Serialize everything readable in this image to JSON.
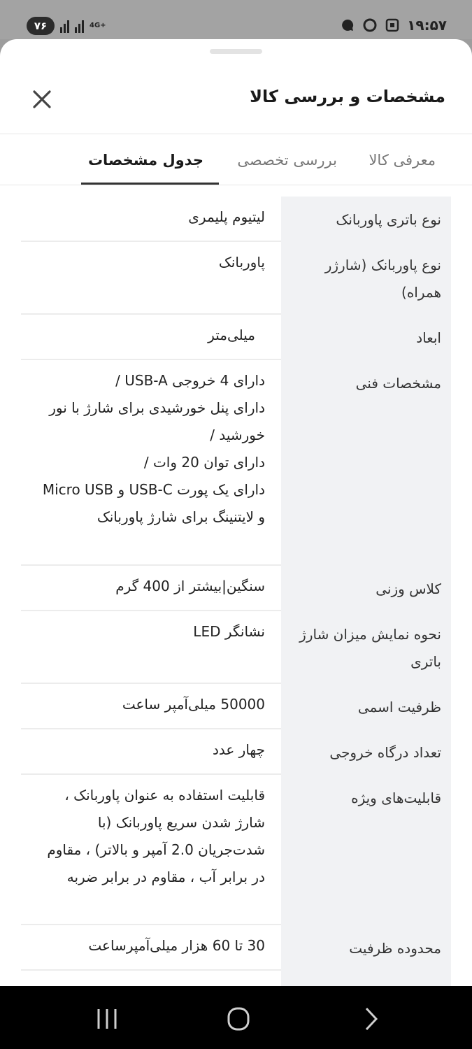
{
  "status_bar": {
    "battery": "۷۶",
    "network": "4G+",
    "time": "۱۹:۵۷"
  },
  "sheet": {
    "title": "مشخصات و بررسی کالا",
    "close_icon": "close-icon"
  },
  "tabs": [
    {
      "label": "معرفی کالا"
    },
    {
      "label": "بررسی تخصصی"
    },
    {
      "label": "جدول مشخصات",
      "active": true
    }
  ],
  "specs": [
    {
      "key": "نوع باتری پاوربانک",
      "value": "لیتیوم پلیمری"
    },
    {
      "key": "نوع پاوربانک (شارژر همراه)",
      "value": "پاوربانک"
    },
    {
      "key": "ابعاد",
      "value": "میلی‌متر"
    },
    {
      "key": "مشخصات فنی",
      "value": "دارای 4 خروجی USB-A /\nدارای پنل خورشیدی برای شارژ با نور خورشید /\nدارای توان 20 وات /\nدارای یک پورت USB-C و Micro USB و لایتنینگ برای شارژ پاوربانک"
    },
    {
      "key": "کلاس وزنی",
      "value": "سنگین|بیشتر از 400 گرم"
    },
    {
      "key": "نحوه نمایش میزان شارژ باتری",
      "value": "نشانگر LED"
    },
    {
      "key": "ظرفیت اسمی",
      "value": "50000 میلی‌آمپر ساعت"
    },
    {
      "key": "تعداد درگاه خروجی",
      "value": "چهار عدد"
    },
    {
      "key": "قابلیت‌های ویژه",
      "value": "قابلیت استفاده به عنوان پاوربانک ، شارژ شدن سریع پاوربانک (با شدت‌جریان 2.0 آمپر و بالاتر) ، مقاوم در برابر آب ، مقاوم در برابر ضربه"
    },
    {
      "key": "محدوده ظرفیت",
      "value": "30 تا 60 هزار میلی‌آمپرساعت"
    }
  ],
  "nav_bar": {
    "recent": "recent-apps-icon",
    "home": "home-icon",
    "back": "back-icon"
  }
}
